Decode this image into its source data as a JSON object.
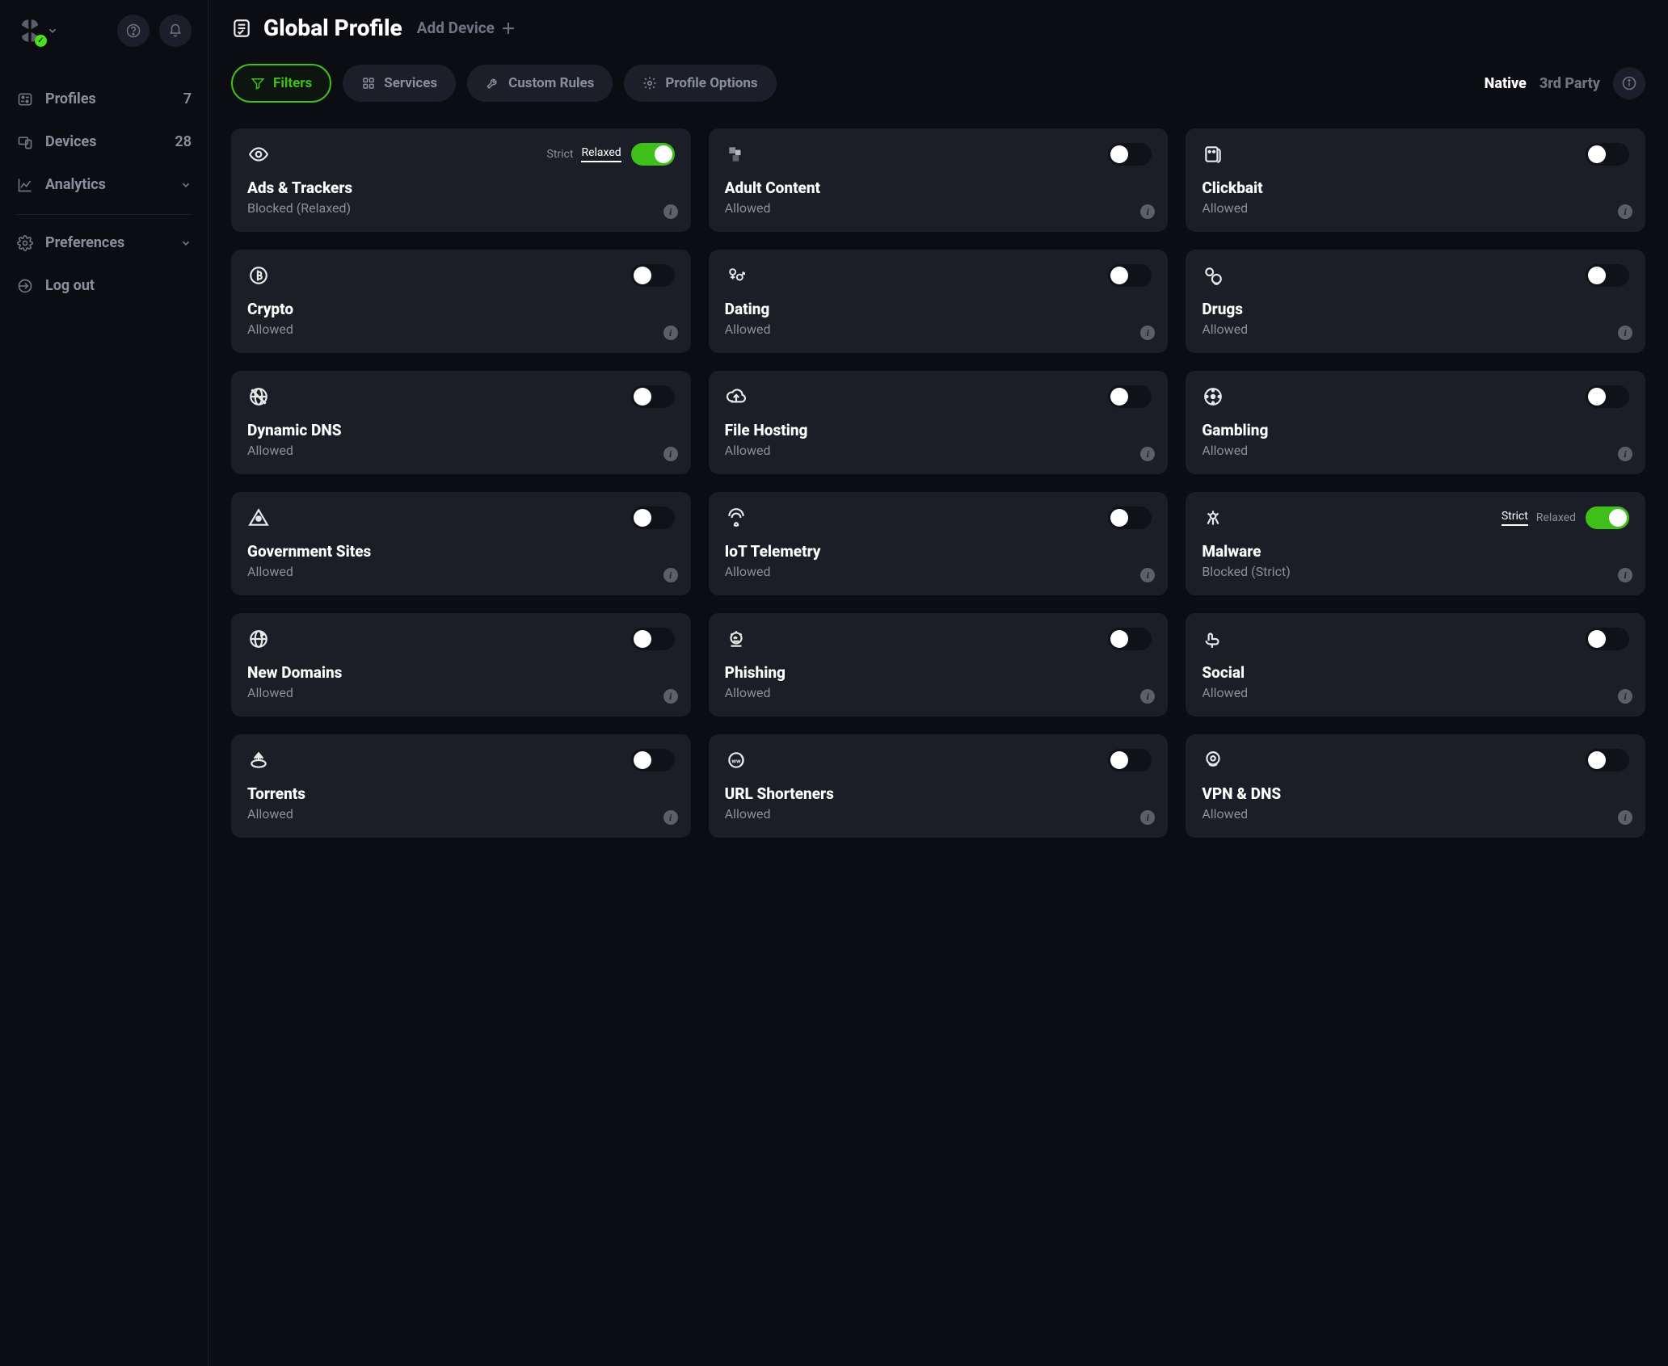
{
  "sidebar": {
    "items": [
      {
        "label": "Profiles",
        "count": "7"
      },
      {
        "label": "Devices",
        "count": "28"
      },
      {
        "label": "Analytics"
      },
      {
        "label": "Preferences"
      },
      {
        "label": "Log out"
      }
    ]
  },
  "header": {
    "title": "Global Profile",
    "add_device": "Add Device"
  },
  "toolbar": {
    "filters": "Filters",
    "services": "Services",
    "custom_rules": "Custom Rules",
    "profile_options": "Profile Options",
    "native": "Native",
    "third_party": "3rd Party"
  },
  "mode_labels": {
    "strict": "Strict",
    "relaxed": "Relaxed"
  },
  "status": {
    "allowed": "Allowed",
    "blocked_relaxed": "Blocked (Relaxed)",
    "blocked_strict": "Blocked (Strict)"
  },
  "cards": [
    {
      "title": "Ads & Trackers",
      "status_key": "blocked_relaxed",
      "enabled": true,
      "mode": "relaxed"
    },
    {
      "title": "Adult Content",
      "status_key": "allowed",
      "enabled": false
    },
    {
      "title": "Clickbait",
      "status_key": "allowed",
      "enabled": false
    },
    {
      "title": "Crypto",
      "status_key": "allowed",
      "enabled": false
    },
    {
      "title": "Dating",
      "status_key": "allowed",
      "enabled": false
    },
    {
      "title": "Drugs",
      "status_key": "allowed",
      "enabled": false
    },
    {
      "title": "Dynamic DNS",
      "status_key": "allowed",
      "enabled": false
    },
    {
      "title": "File Hosting",
      "status_key": "allowed",
      "enabled": false
    },
    {
      "title": "Gambling",
      "status_key": "allowed",
      "enabled": false
    },
    {
      "title": "Government Sites",
      "status_key": "allowed",
      "enabled": false
    },
    {
      "title": "IoT Telemetry",
      "status_key": "allowed",
      "enabled": false
    },
    {
      "title": "Malware",
      "status_key": "blocked_strict",
      "enabled": true,
      "mode": "strict"
    },
    {
      "title": "New Domains",
      "status_key": "allowed",
      "enabled": false
    },
    {
      "title": "Phishing",
      "status_key": "allowed",
      "enabled": false
    },
    {
      "title": "Social",
      "status_key": "allowed",
      "enabled": false
    },
    {
      "title": "Torrents",
      "status_key": "allowed",
      "enabled": false
    },
    {
      "title": "URL Shorteners",
      "status_key": "allowed",
      "enabled": false
    },
    {
      "title": "VPN & DNS",
      "status_key": "allowed",
      "enabled": false
    }
  ]
}
